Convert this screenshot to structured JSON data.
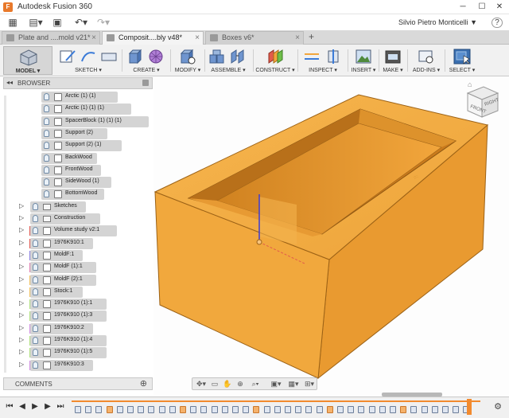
{
  "window": {
    "title": "Autodesk Fusion 360",
    "user": "Silvio Pietro Monticelli ▼",
    "help": "?",
    "controls": {
      "minimize": "─",
      "maximize": "☐",
      "close": "✕"
    }
  },
  "quick_access": {
    "data_panel": "▦",
    "file": "▤▾",
    "save": "▣",
    "undo": "↶▾",
    "redo": "↷▾"
  },
  "tabs": [
    {
      "label": "Plate and ....mold v21*",
      "close": "×"
    },
    {
      "label": "Composit....bly v48*",
      "close": "×"
    },
    {
      "label": "Boxes v6*",
      "close": "×"
    }
  ],
  "tabs_plus": "+",
  "toolbar": {
    "workspace_label": "MODEL ▾",
    "groups": [
      {
        "label": "SKETCH ▾",
        "icon": "sketch-icon"
      },
      {
        "label": "CREATE ▾",
        "icon": "create-box-icon"
      },
      {
        "label": "MODIFY ▾",
        "icon": "modify-icon"
      },
      {
        "label": "ASSEMBLE ▾",
        "icon": "assemble-icon"
      },
      {
        "label": "CONSTRUCT ▾",
        "icon": "construct-plane-icon"
      },
      {
        "label": "INSPECT ▾",
        "icon": "inspect-icon"
      },
      {
        "label": "INSERT ▾",
        "icon": "insert-image-icon"
      },
      {
        "label": "MAKE ▾",
        "icon": "make-icon"
      },
      {
        "label": "ADD-INS ▾",
        "icon": "add-ins-icon"
      },
      {
        "label": "SELECT ▾",
        "icon": "select-icon"
      }
    ]
  },
  "browser": {
    "title": "BROWSER",
    "back": "◂◂",
    "items": [
      {
        "label": "Arctic (1) (1)"
      },
      {
        "label": "Arctic (1) (1) (1)"
      },
      {
        "label": "SpacerBlock (1) (1) (1)"
      },
      {
        "label": "Support (2)"
      },
      {
        "label": "Support (2) (1)"
      },
      {
        "label": "BackWood"
      },
      {
        "label": "FrontWood"
      },
      {
        "label": "SideWood (1)"
      },
      {
        "label": "BottomWood"
      },
      {
        "label": "Sketches",
        "expand": "▷",
        "folder": true
      },
      {
        "label": "Construction",
        "expand": "▷",
        "folder": true
      },
      {
        "label": "Volume study v2:1",
        "expand": "▷",
        "color": "#e0574f"
      },
      {
        "label": "1976K910:1",
        "expand": "▷",
        "color": "#e0574f"
      },
      {
        "label": "MoldF:1",
        "expand": "▷",
        "color": "#8a7fe0"
      },
      {
        "label": "MoldF (1):1",
        "expand": "▷",
        "color": "#e07fb0"
      },
      {
        "label": "MoldF (2):1",
        "expand": "▷",
        "color": "#f0c060"
      },
      {
        "label": "Stock:1",
        "expand": "▷",
        "color": "#f0c060"
      },
      {
        "label": "1976K910 (1):1",
        "expand": "▷",
        "color": "#b0e07f"
      },
      {
        "label": "1976K910 (1):3",
        "expand": "▷",
        "color": "#b0e07f"
      },
      {
        "label": "1976K910:2",
        "expand": "▷",
        "color": "#d08fe0"
      },
      {
        "label": "1976K910 (1):4",
        "expand": "▷",
        "color": "#b0e07f"
      },
      {
        "label": "1976K910 (1):5",
        "expand": "▷",
        "color": "#b0e07f"
      },
      {
        "label": "1976K910:3",
        "expand": "▷",
        "color": "#d08fe0"
      }
    ]
  },
  "comments": {
    "label": "COMMENTS",
    "add": "⊕"
  },
  "viewcube": {
    "front": "FRONT",
    "right": "RIGHT"
  },
  "model": {
    "color": "#f2a63c"
  },
  "navbar": [
    "✥▾",
    "▭",
    "✋",
    "⊕",
    "⌕▾",
    "▣▾",
    "▦▾",
    "⊞▾"
  ],
  "timeline": {
    "controls": [
      "⏮",
      "◀",
      "▶",
      "▶",
      "⏭"
    ],
    "settings": "⚙",
    "features": 38
  }
}
